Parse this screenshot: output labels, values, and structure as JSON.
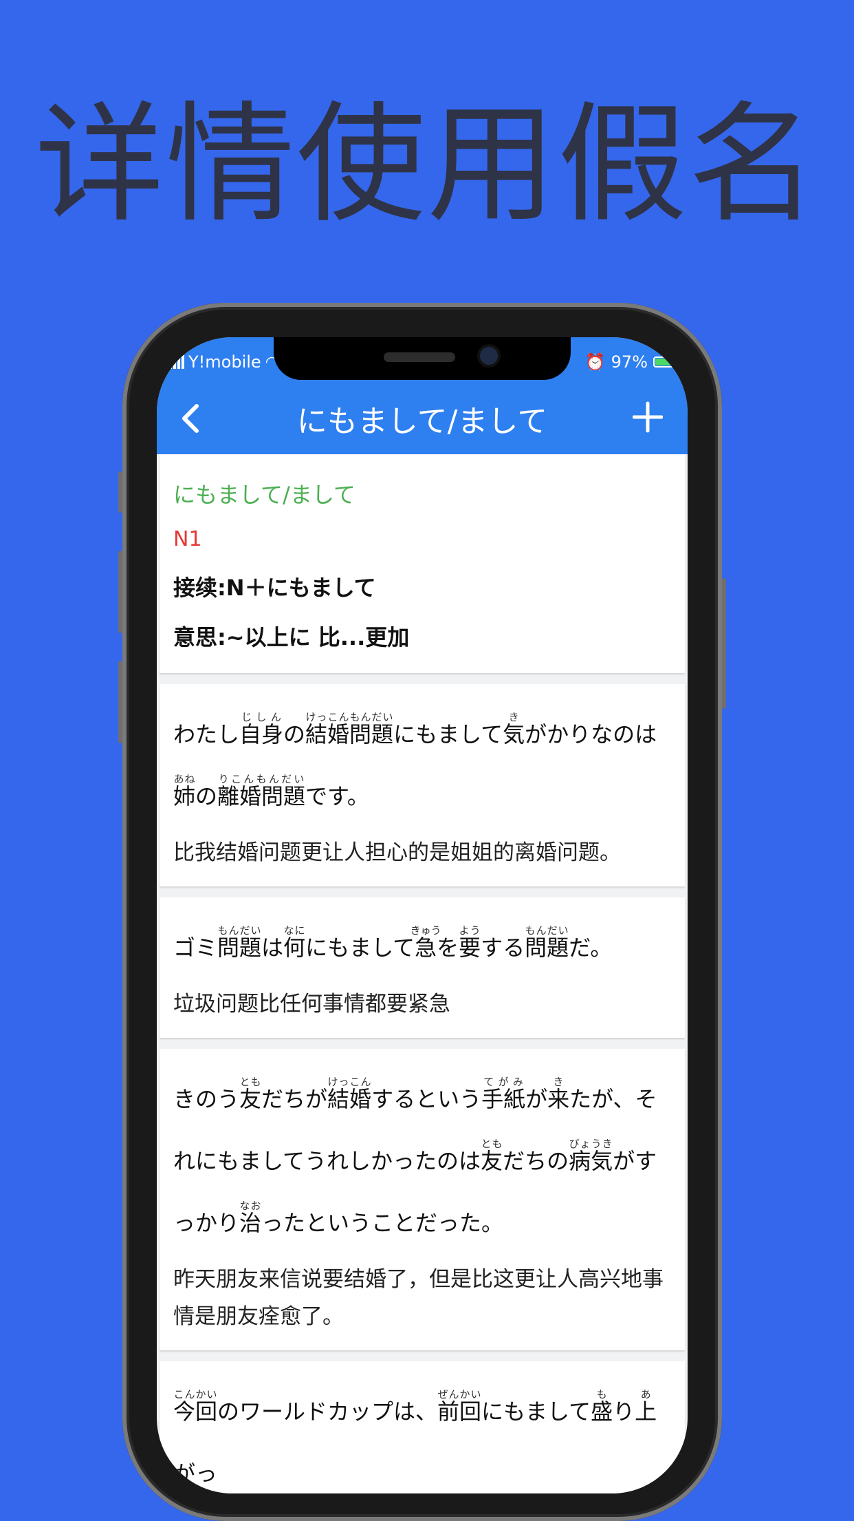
{
  "headline": "详情使用假名",
  "status": {
    "carrier": "Y!mobile",
    "battery": "97%"
  },
  "nav": {
    "title": "にもまして/まして",
    "back_icon": "chevron-left-icon",
    "add_icon": "plus-icon"
  },
  "grammar": {
    "title": "にもまして/まして",
    "level": "N1",
    "connection": "接续:N＋にもまして",
    "meaning": "意思:~以上に  比...更加"
  },
  "examples": [
    {
      "jp_html": "わたし<ruby>自身<rt>じしん</rt></ruby>の<ruby>結婚問題<rt>けっこんもんだい</rt></ruby>にもまして<ruby>気<rt>き</rt></ruby>がかりなのは<ruby>姉<rt>あね</rt></ruby>の<ruby>離婚問題<rt>りこんもんだい</rt></ruby>です。",
      "cn": "比我结婚问题更让人担心的是姐姐的离婚问题。"
    },
    {
      "jp_html": "ゴミ<ruby>問題<rt>もんだい</rt></ruby>は<ruby>何<rt>なに</rt></ruby>にもまして<ruby>急<rt>きゅう</rt></ruby>を<ruby>要<rt>よう</rt></ruby>する<ruby>問題<rt>もんだい</rt></ruby>だ。",
      "cn": "垃圾问题比任何事情都要紧急"
    },
    {
      "jp_html": "きのう<ruby>友<rt>とも</rt></ruby>だちが<ruby>結婚<rt>けっこん</rt></ruby>するという<ruby>手紙<rt>てがみ</rt></ruby>が<ruby>来<rt>き</rt></ruby>たが、それにもましてうれしかったのは<ruby>友<rt>とも</rt></ruby>だちの<ruby>病気<rt>びょうき</rt></ruby>がすっかり<ruby>治<rt>なお</rt></ruby>ったということだった。",
      "cn": "昨天朋友来信说要结婚了，但是比这更让人高兴地事情是朋友痊愈了。"
    },
    {
      "jp_html": "<ruby>今回<rt>こんかい</rt></ruby>のワールドカップは、<ruby>前回<rt>ぜんかい</rt></ruby>にもまして<ruby>盛<rt>も</rt></ruby>り<ruby>上<rt>あ</rt></ruby>がっ",
      "cn": ""
    }
  ]
}
